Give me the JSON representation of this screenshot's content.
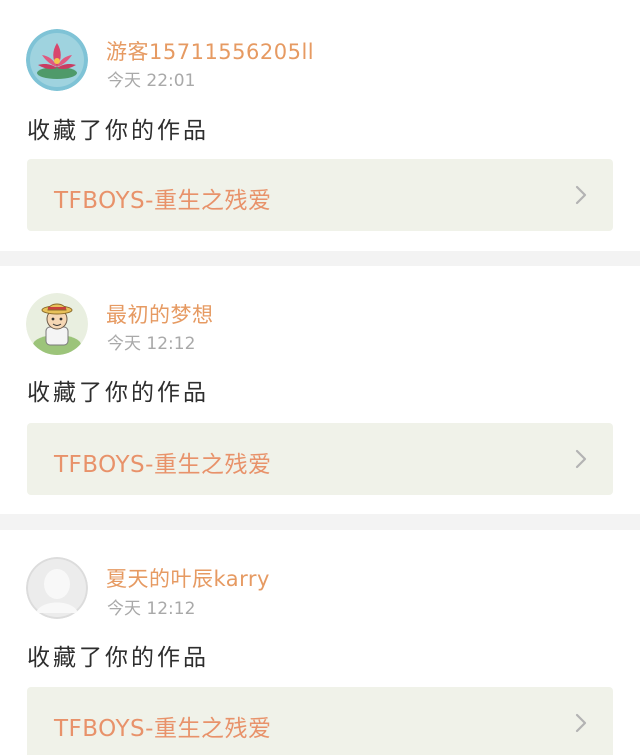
{
  "colors": {
    "username": "#e69a62",
    "work_title": "#e8926a",
    "timestamp": "#a9a9a9",
    "action_text": "#2e2e2e",
    "link_background": "#f0f2e9",
    "divider": "#f3f3f3"
  },
  "notifications": [
    {
      "avatar_icon": "pink-lotus-avatar-icon",
      "username": "游客15711556205ll",
      "time": "今天 22:01",
      "action": "收藏了你的作品",
      "work_title": "TFBOYS-重生之残爱",
      "chevron_icon": "chevron-right-icon"
    },
    {
      "avatar_icon": "cartoon-character-avatar-icon",
      "username": "最初的梦想",
      "time": "今天 12:12",
      "action": "收藏了你的作品",
      "work_title": "TFBOYS-重生之残爱",
      "chevron_icon": "chevron-right-icon"
    },
    {
      "avatar_icon": "default-user-avatar-icon",
      "username": "夏天的叶辰karry",
      "time": "今天 12:12",
      "action": "收藏了你的作品",
      "work_title": "TFBOYS-重生之残爱",
      "chevron_icon": "chevron-right-icon"
    }
  ]
}
